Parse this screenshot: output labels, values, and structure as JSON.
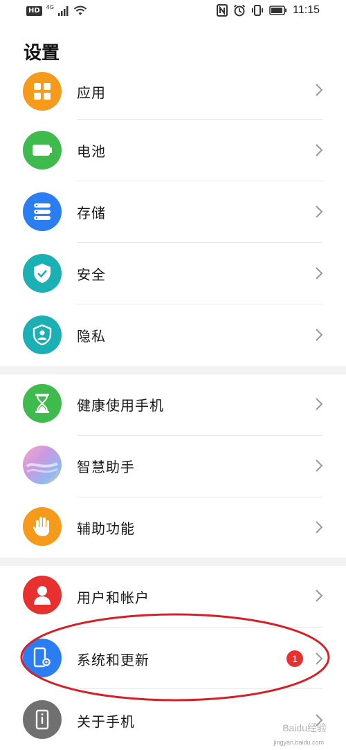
{
  "status_bar": {
    "hd": "HD",
    "network": "4G",
    "time": "11:15"
  },
  "title": "设置",
  "items": [
    {
      "label": "应用",
      "icon": "apps-icon",
      "color": "#f59a1b"
    },
    {
      "label": "电池",
      "icon": "battery-icon",
      "color": "#3fba4c"
    },
    {
      "label": "存储",
      "icon": "storage-icon",
      "color": "#2b7ef2"
    },
    {
      "label": "安全",
      "icon": "shield-check-icon",
      "color": "#1ab0b4"
    },
    {
      "label": "隐私",
      "icon": "privacy-shield-icon",
      "color": "#1ab0b4"
    },
    {
      "label": "健康使用手机",
      "icon": "hourglass-icon",
      "color": "#3fba4c"
    },
    {
      "label": "智慧助手",
      "icon": "assistant-icon",
      "color": "#c89ae0"
    },
    {
      "label": "辅助功能",
      "icon": "hand-icon",
      "color": "#f59a1b"
    },
    {
      "label": "用户和帐户",
      "icon": "user-icon",
      "color": "#e8302e"
    },
    {
      "label": "系统和更新",
      "icon": "system-update-icon",
      "color": "#2b7ef2",
      "badge": "1"
    },
    {
      "label": "关于手机",
      "icon": "about-phone-icon",
      "color": "#707070"
    }
  ],
  "watermark": {
    "text": "Baidu经验",
    "url": "jingyan.baidu.com"
  }
}
